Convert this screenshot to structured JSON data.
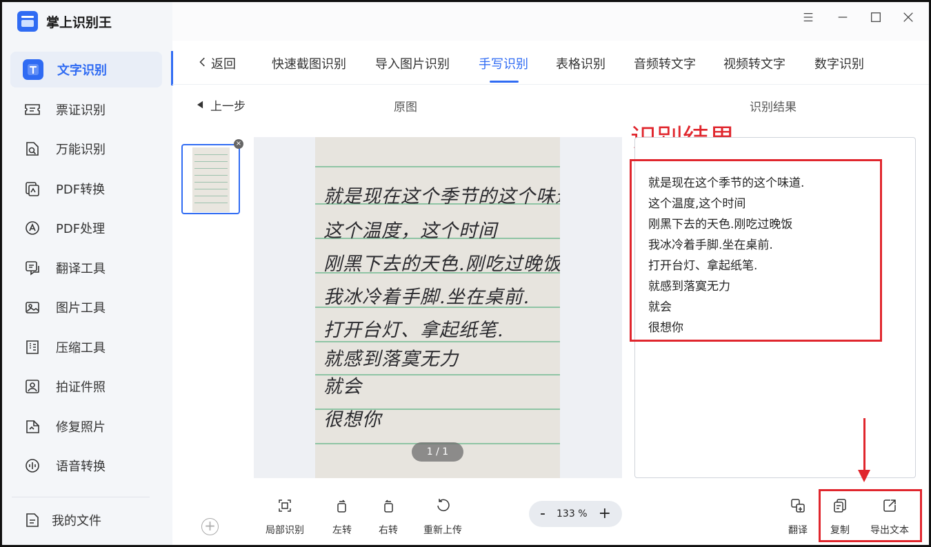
{
  "app": {
    "name": "掌上识别王"
  },
  "sidebar": {
    "items": [
      {
        "label": "文字识别",
        "icon": "text-recognition-icon",
        "active": true
      },
      {
        "label": "票证识别",
        "icon": "ticket-icon"
      },
      {
        "label": "万能识别",
        "icon": "universal-scan-icon"
      },
      {
        "label": "PDF转换",
        "icon": "pdf-convert-icon"
      },
      {
        "label": "PDF处理",
        "icon": "pdf-process-icon"
      },
      {
        "label": "翻译工具",
        "icon": "translate-icon"
      },
      {
        "label": "图片工具",
        "icon": "image-tool-icon"
      },
      {
        "label": "压缩工具",
        "icon": "compress-icon"
      },
      {
        "label": "拍证件照",
        "icon": "id-photo-icon"
      },
      {
        "label": "修复照片",
        "icon": "repair-photo-icon"
      },
      {
        "label": "语音转换",
        "icon": "voice-convert-icon"
      }
    ],
    "my_files": "我的文件"
  },
  "tabs": {
    "back_label": "返回",
    "items": [
      "快速截图识别",
      "导入图片识别",
      "手写识别",
      "表格识别",
      "音频转文字",
      "视频转文字",
      "数字识别"
    ],
    "active_index": 2
  },
  "workspace": {
    "prev_step": "上一步",
    "original_header": "原图",
    "result_header": "识别结果",
    "page_indicator": "1 / 1"
  },
  "handwriting_lines": [
    "就是现在这个季节的这个味道.",
    "这个温度，这个时间",
    "刚黑下去的天色.刚吃过晚饭",
    "我冰冷着手脚.坐在桌前.",
    "打开台灯、拿起纸笔.",
    "就感到落寞无力",
    "就会",
    "很想你"
  ],
  "annotation": {
    "title": "识别结果",
    "color": "#e0262d"
  },
  "result": {
    "lines": [
      "就是现在这个季节的这个味道.",
      "这个温度,这个时间",
      "刚黑下去的天色.刚吃过晚饭",
      "我冰冷着手脚.坐在桌前.",
      "打开台灯、拿起纸笔.",
      "就感到落寞无力",
      "就会",
      "很想你"
    ]
  },
  "toolbar": {
    "partial": "局部识别",
    "rotate_left": "左转",
    "rotate_right": "右转",
    "reupload": "重新上传",
    "zoom": "133 %",
    "zoom_minus": "-",
    "zoom_plus": "+",
    "translate": "翻译",
    "copy": "复制",
    "export": "导出文本"
  },
  "colors": {
    "accent": "#2f6bf3",
    "highlight": "#e0262d"
  }
}
